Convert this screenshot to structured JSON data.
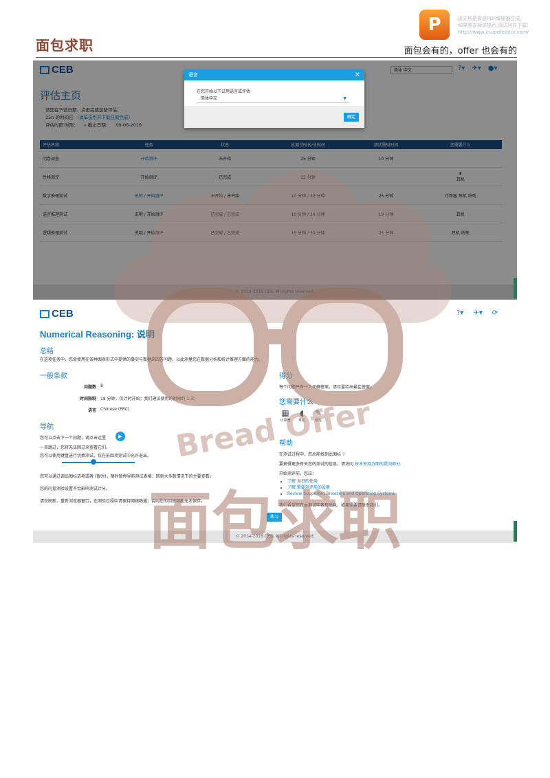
{
  "page_header": {
    "brand": "面包求职",
    "slogan": "面包会有的，offer 也会有的",
    "pdf_note_lines": [
      "该文档是极速PDF编辑器生成,",
      "如果想去掉该提示,请访问并下载:",
      "http://www.jisupdfeditor.com/"
    ]
  },
  "shot1": {
    "logo": "CEB",
    "title": "评估主页",
    "info_line1": "请您在下述日期，点击完成这些评估：",
    "info_line2_prefix": "25n 的时间已",
    "info_line2_link": "（请单击引开下载日期完成）",
    "info_line3_label": "评估时限 时限：",
    "info_line3_date_label": "» 截止日期：",
    "info_line3_date": "09-06-2016",
    "lang_select": "简体 中文",
    "dialog": {
      "title": "语言",
      "close": "✕",
      "label": "在您开始以下试用语言或评估",
      "select_value": "简体中文",
      "ok": "确定"
    },
    "table": {
      "headers": [
        "评估名称",
        "任务",
        "状态",
        "总测试时长/总时间",
        "测试需时时间",
        "您需要什么"
      ],
      "rows": [
        {
          "name": "问卷调查",
          "task": "开始测评",
          "status": "未开始",
          "total": "25 分钟",
          "need": "10 分钟",
          "tools": ""
        },
        {
          "name": "性格测评",
          "task": "开始测评",
          "status": "已完成",
          "total": "25 分钟",
          "need": "",
          "tools": "耳机"
        },
        {
          "name": "数字推理测试",
          "task": "说明 / 开始测评",
          "status": "未开始 / 未开始",
          "total": "10 分钟 / 30 分钟",
          "need": "25 分钟",
          "tools": "计算器  耳机  纸笔"
        },
        {
          "name": "语言推理测试",
          "task": "说明 / 开始测评",
          "status": "已完成 / 已完成",
          "total": "10 分钟 / 30 分钟",
          "need": "19 分钟",
          "tools": "耳机"
        },
        {
          "name": "逻辑推理测试",
          "task": "说明 / 开始测评",
          "status": "已完成 / 已完成",
          "total": "10 分钟 / 30 分钟",
          "need": "25 分钟",
          "tools": "耳机  纸笔"
        }
      ]
    },
    "footer": "© 2016-2016 CEB. All rights reserved."
  },
  "shot2": {
    "logo": "CEB",
    "title": "Numerical Reasoning: 说明",
    "summary_heading": "总结",
    "summary_text": "在这项任务中，您会使用在各种图表形式中提供的事实与数据来回答问题，以此测量您在数据分析和统计推理方面的能力。",
    "general_heading": "一般条款",
    "kv": [
      {
        "label": "问题数",
        "value": "8"
      },
      {
        "label": "时间限制",
        "value": "18 分钟，仅计时开始；我们建议使用的时间约 1 次"
      },
      {
        "label": "语言",
        "value": "Chinese (PRC)"
      }
    ],
    "nav_heading": "导航",
    "nav_line1": "您可以点击下一个问题，请点击这里",
    "nav_line2": "一旦跳过，您将无法回过来查看它们。",
    "nav_line3": "您可以使用键盘进行切换测试，仅在前四项测试中允许退出。",
    "nav_line4": "您可以通过调出图标选项或者 (暂时)，随时暂停导航测试表格，回到大多数情况下的主要查看；",
    "nav_line5": "您的问卷测验设置不会影响测试计分。",
    "nav_line6": "请勿刷新、重新浏览器窗口，在测验过程中请保持网络畅通；否则您的回答可能无法保存。",
    "scoring_heading": "得分",
    "scoring_text": "每个问题只有一个正确答案。请尽量给出最佳答案。",
    "need_heading": "您需要什么",
    "tools": [
      {
        "icon": "▦",
        "label": "计算器"
      },
      {
        "icon": "◖",
        "label": "耳机"
      },
      {
        "icon": "✎",
        "label": "纸笔"
      }
    ],
    "help_heading": "帮助",
    "help_line1": "在测试过程中，您总能找到此图标",
    "help_line2_prefix": "要获得更多有关您的测试的信息，请访问",
    "help_line2_link": "技术支持方面的提问部分",
    "help_line3": "开始测评前，您应：",
    "help_bullets": [
      "了解 当日的任务",
      "了解 需要测评前的设备",
      "Review Supported Browsers and Operating Systems"
    ],
    "help_line4": "我们希望您在本测试中表现出色，如果需要请联系我们。",
    "start_button": "练习",
    "footer": "© 2014-2016 CEB. All rights reserved."
  },
  "watermark": {
    "text": "Bread Offer",
    "chinese": "面包求职"
  },
  "colors": {
    "accent": "#1a7fc1",
    "header_navy": "#1a4f8a",
    "brand": "#8a4a3a",
    "watermark": "#b08070"
  }
}
